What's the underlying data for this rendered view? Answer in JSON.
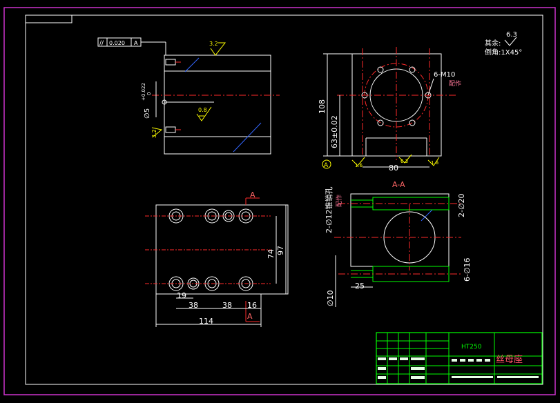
{
  "drawing": {
    "colors": {
      "background": "#000000",
      "outline": "#ffffff",
      "border": "#cc33cc",
      "centerline": "#ff2a2a",
      "dimension": "#ffffff",
      "annotation": "#ffff00",
      "hidden": "#3366ff",
      "titleblock": "#00ff00",
      "red_text": "#ff6666",
      "pink_text": "#ff7799"
    },
    "tolerance_frame": {
      "symbol": "//",
      "value": "0.020",
      "datum": "A"
    },
    "roughness_marks": [
      "3.2",
      "0.8",
      "3.2",
      "1.6",
      "6.3",
      "1.6"
    ],
    "top_notes": {
      "rest_label": "其余:",
      "rest_value": "6.3",
      "chamfer": "倒角:1X45°"
    },
    "front_view": {
      "diameter_dim": "∅5",
      "tol_upper": "+0.022",
      "tol_lower": "0"
    },
    "side_view": {
      "height_dim": "108",
      "center_height_dim": "63±0.02",
      "width_dim": "80",
      "thread_callout": "6-M10",
      "thread_note": "配作",
      "datum_label": "A"
    },
    "plan_view": {
      "section_mark_top": "A",
      "section_mark_bottom": "A",
      "dim_74": "74",
      "dim_97": "97",
      "dim_19": "19",
      "dim_38a": "38",
      "dim_38b": "38",
      "dim_16": "16",
      "dim_114": "114"
    },
    "section_view": {
      "title": "A-A",
      "pin_hole": "2-∅12锥销孔",
      "pin_note": "配作",
      "dim_phi20": "2-∅20",
      "dim_phi16": "6-∅16",
      "dim_phi10": "∅10",
      "dim_25": "25"
    },
    "title_block": {
      "material": "HT250",
      "part_name": "丝母座"
    }
  }
}
